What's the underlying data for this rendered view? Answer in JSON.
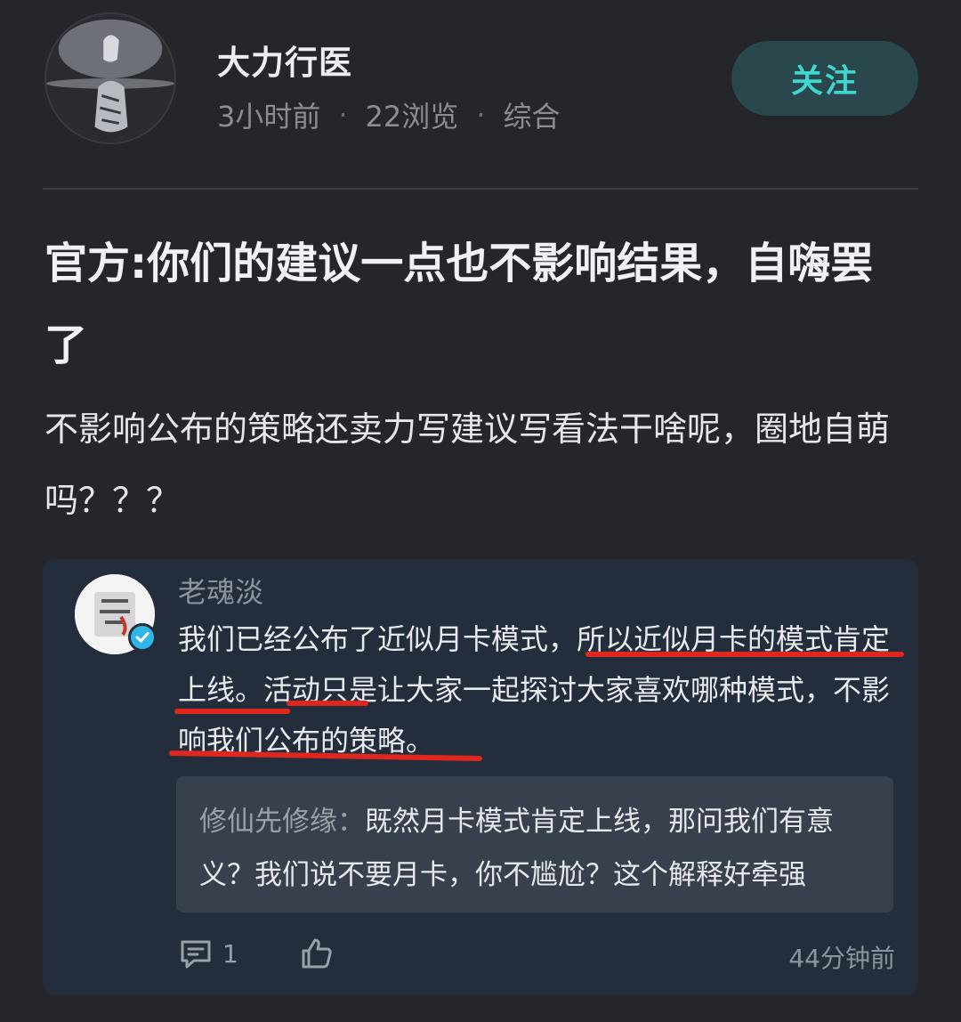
{
  "header": {
    "author_name": "大力行医",
    "time_ago": "3小时前",
    "dot": "·",
    "views": "22浏览",
    "category": "综合",
    "follow_label": "关注"
  },
  "post": {
    "title": "官方:你们的建议一点也不影响结果，自嗨罢了",
    "body": "不影响公布的策略还卖力写建议写看法干啥呢，圈地自萌吗？？？"
  },
  "comment": {
    "author": "老魂淡",
    "text": "我们已经公布了近似月卡模式，所以近似月卡的模式肯定上线。活动只是让大家一起探讨大家喜欢哪种模式，不影响我们公布的策略。",
    "reply": {
      "author": "修仙先修缘：",
      "text": "既然月卡模式肯定上线，那问我们有意义？我们说不要月卡，你不尴尬？这个解释好牵强"
    },
    "reply_count": "1",
    "time_ago": "44分钟前",
    "highlight_color": "#e0261d"
  },
  "colors": {
    "background": "#25262b",
    "card": "#232d3b",
    "accent": "#3fd6d0"
  },
  "icons": {
    "comment": "comment-icon",
    "like": "thumbs-up-icon",
    "verified": "verified-badge-icon"
  }
}
